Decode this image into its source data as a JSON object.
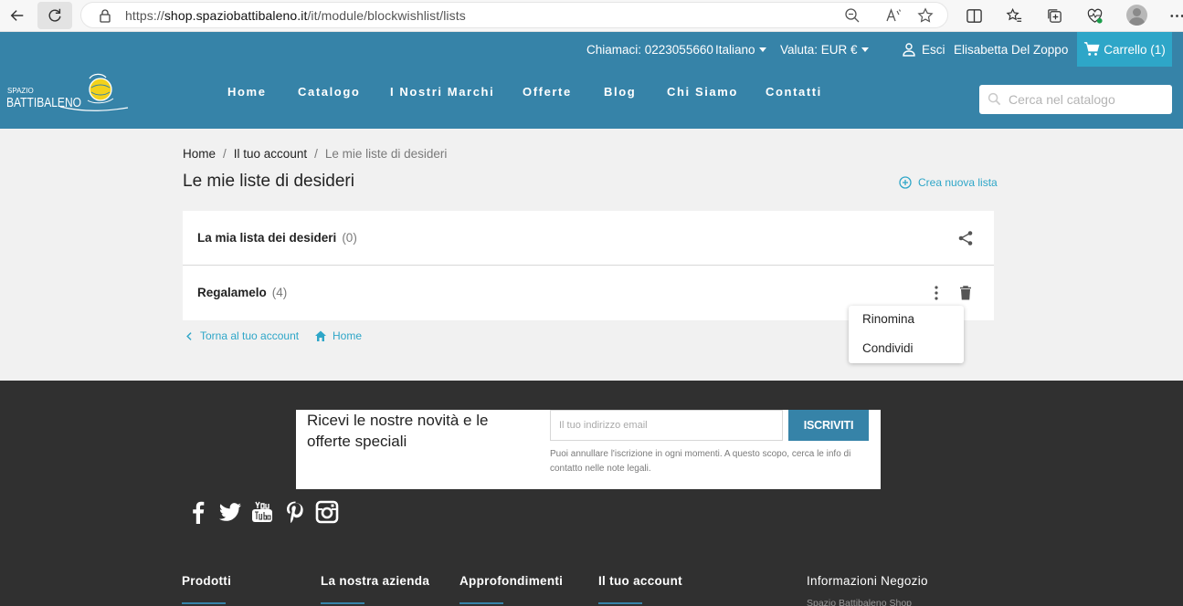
{
  "browser": {
    "url_prefix": "https://",
    "url_host": "shop.spaziobattibaleno.it",
    "url_path": "/it/module/blockwishlist/lists"
  },
  "header": {
    "phone": "Chiamaci: 0223055660",
    "language": "Italiano",
    "currency": "Valuta: EUR €",
    "logout": "Esci",
    "user": "Elisabetta Del Zoppo",
    "cart": "Carrello (1)",
    "logo_small": "SPAZIO",
    "logo_big": "BATTIBALENO",
    "search_placeholder": "Cerca nel catalogo",
    "nav": [
      "Home",
      "Catalogo",
      "I Nostri Marchi",
      "Offerte",
      "Blog",
      "Chi Siamo",
      "Contatti"
    ]
  },
  "breadcrumb": [
    "Home",
    "Il tuo account",
    "Le mie liste di desideri"
  ],
  "page": {
    "title": "Le mie liste di desideri",
    "create_list": "Crea nuova lista",
    "lists": [
      {
        "name": "La mia lista dei desideri",
        "count": "(0)"
      },
      {
        "name": "Regalamelo",
        "count": "(4)"
      }
    ],
    "menu": [
      "Rinomina",
      "Condividi"
    ],
    "back_account": "Torna al tuo account",
    "home": "Home"
  },
  "footer": {
    "newsletter_title": "Ricevi le nostre novità e le offerte speciali",
    "email_placeholder": "Il tuo indirizzo email",
    "subscribe": "ISCRIVITI",
    "note": "Puoi annullare l'iscrizione in ogni momenti. A questo scopo, cerca le info di contatto nelle note legali.",
    "columns": [
      "Prodotti",
      "La nostra azienda",
      "Approfondimenti",
      "Il tuo account",
      "Informazioni Negozio"
    ],
    "store_name": "Spazio Battibaleno Shop"
  },
  "colors": {
    "header_blue": "#3683a8",
    "accent_cyan": "#2ea6c8",
    "footer_dark": "#303030"
  }
}
